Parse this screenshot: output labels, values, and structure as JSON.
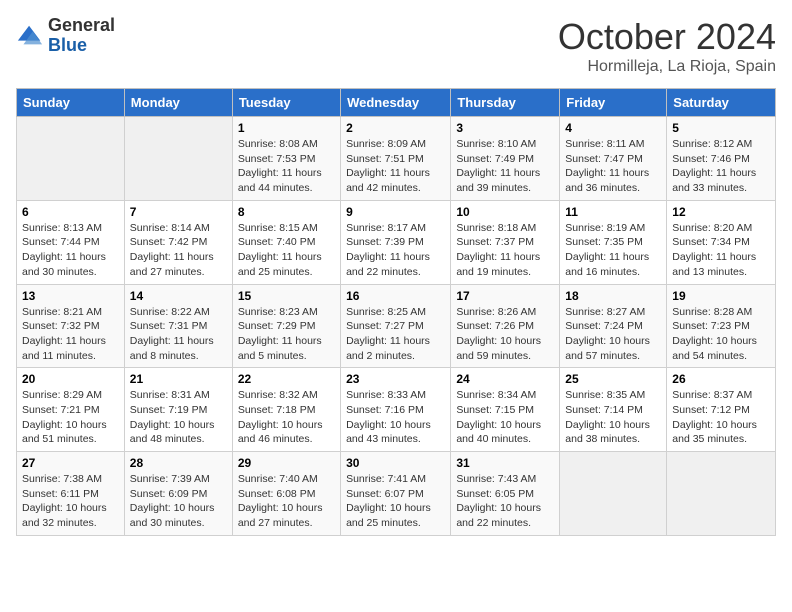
{
  "header": {
    "logo": {
      "line1": "General",
      "line2": "Blue"
    },
    "title": "October 2024",
    "location": "Hormilleja, La Rioja, Spain"
  },
  "weekdays": [
    "Sunday",
    "Monday",
    "Tuesday",
    "Wednesday",
    "Thursday",
    "Friday",
    "Saturday"
  ],
  "weeks": [
    [
      {
        "day": "",
        "info": ""
      },
      {
        "day": "",
        "info": ""
      },
      {
        "day": "1",
        "info": "Sunrise: 8:08 AM\nSunset: 7:53 PM\nDaylight: 11 hours and 44 minutes."
      },
      {
        "day": "2",
        "info": "Sunrise: 8:09 AM\nSunset: 7:51 PM\nDaylight: 11 hours and 42 minutes."
      },
      {
        "day": "3",
        "info": "Sunrise: 8:10 AM\nSunset: 7:49 PM\nDaylight: 11 hours and 39 minutes."
      },
      {
        "day": "4",
        "info": "Sunrise: 8:11 AM\nSunset: 7:47 PM\nDaylight: 11 hours and 36 minutes."
      },
      {
        "day": "5",
        "info": "Sunrise: 8:12 AM\nSunset: 7:46 PM\nDaylight: 11 hours and 33 minutes."
      }
    ],
    [
      {
        "day": "6",
        "info": "Sunrise: 8:13 AM\nSunset: 7:44 PM\nDaylight: 11 hours and 30 minutes."
      },
      {
        "day": "7",
        "info": "Sunrise: 8:14 AM\nSunset: 7:42 PM\nDaylight: 11 hours and 27 minutes."
      },
      {
        "day": "8",
        "info": "Sunrise: 8:15 AM\nSunset: 7:40 PM\nDaylight: 11 hours and 25 minutes."
      },
      {
        "day": "9",
        "info": "Sunrise: 8:17 AM\nSunset: 7:39 PM\nDaylight: 11 hours and 22 minutes."
      },
      {
        "day": "10",
        "info": "Sunrise: 8:18 AM\nSunset: 7:37 PM\nDaylight: 11 hours and 19 minutes."
      },
      {
        "day": "11",
        "info": "Sunrise: 8:19 AM\nSunset: 7:35 PM\nDaylight: 11 hours and 16 minutes."
      },
      {
        "day": "12",
        "info": "Sunrise: 8:20 AM\nSunset: 7:34 PM\nDaylight: 11 hours and 13 minutes."
      }
    ],
    [
      {
        "day": "13",
        "info": "Sunrise: 8:21 AM\nSunset: 7:32 PM\nDaylight: 11 hours and 11 minutes."
      },
      {
        "day": "14",
        "info": "Sunrise: 8:22 AM\nSunset: 7:31 PM\nDaylight: 11 hours and 8 minutes."
      },
      {
        "day": "15",
        "info": "Sunrise: 8:23 AM\nSunset: 7:29 PM\nDaylight: 11 hours and 5 minutes."
      },
      {
        "day": "16",
        "info": "Sunrise: 8:25 AM\nSunset: 7:27 PM\nDaylight: 11 hours and 2 minutes."
      },
      {
        "day": "17",
        "info": "Sunrise: 8:26 AM\nSunset: 7:26 PM\nDaylight: 10 hours and 59 minutes."
      },
      {
        "day": "18",
        "info": "Sunrise: 8:27 AM\nSunset: 7:24 PM\nDaylight: 10 hours and 57 minutes."
      },
      {
        "day": "19",
        "info": "Sunrise: 8:28 AM\nSunset: 7:23 PM\nDaylight: 10 hours and 54 minutes."
      }
    ],
    [
      {
        "day": "20",
        "info": "Sunrise: 8:29 AM\nSunset: 7:21 PM\nDaylight: 10 hours and 51 minutes."
      },
      {
        "day": "21",
        "info": "Sunrise: 8:31 AM\nSunset: 7:19 PM\nDaylight: 10 hours and 48 minutes."
      },
      {
        "day": "22",
        "info": "Sunrise: 8:32 AM\nSunset: 7:18 PM\nDaylight: 10 hours and 46 minutes."
      },
      {
        "day": "23",
        "info": "Sunrise: 8:33 AM\nSunset: 7:16 PM\nDaylight: 10 hours and 43 minutes."
      },
      {
        "day": "24",
        "info": "Sunrise: 8:34 AM\nSunset: 7:15 PM\nDaylight: 10 hours and 40 minutes."
      },
      {
        "day": "25",
        "info": "Sunrise: 8:35 AM\nSunset: 7:14 PM\nDaylight: 10 hours and 38 minutes."
      },
      {
        "day": "26",
        "info": "Sunrise: 8:37 AM\nSunset: 7:12 PM\nDaylight: 10 hours and 35 minutes."
      }
    ],
    [
      {
        "day": "27",
        "info": "Sunrise: 7:38 AM\nSunset: 6:11 PM\nDaylight: 10 hours and 32 minutes."
      },
      {
        "day": "28",
        "info": "Sunrise: 7:39 AM\nSunset: 6:09 PM\nDaylight: 10 hours and 30 minutes."
      },
      {
        "day": "29",
        "info": "Sunrise: 7:40 AM\nSunset: 6:08 PM\nDaylight: 10 hours and 27 minutes."
      },
      {
        "day": "30",
        "info": "Sunrise: 7:41 AM\nSunset: 6:07 PM\nDaylight: 10 hours and 25 minutes."
      },
      {
        "day": "31",
        "info": "Sunrise: 7:43 AM\nSunset: 6:05 PM\nDaylight: 10 hours and 22 minutes."
      },
      {
        "day": "",
        "info": ""
      },
      {
        "day": "",
        "info": ""
      }
    ]
  ]
}
